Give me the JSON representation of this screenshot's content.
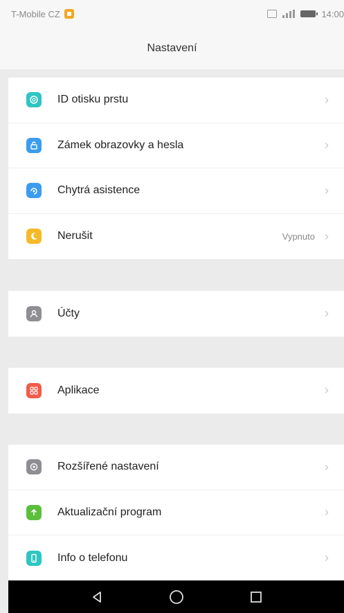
{
  "status_bar": {
    "carrier": "T-Mobile CZ",
    "time": "14:00"
  },
  "header": {
    "title": "Nastavení"
  },
  "groups": [
    {
      "items": [
        {
          "label": "ID otisku prstu",
          "icon": "fingerprint-icon",
          "color": "#2ec5c2"
        },
        {
          "label": "Zámek obrazovky a hesla",
          "icon": "lock-icon",
          "color": "#3b9cf0"
        },
        {
          "label": "Chytrá asistence",
          "icon": "assist-icon",
          "color": "#3b9cf0"
        },
        {
          "label": "Nerušit",
          "value": "Vypnuto",
          "icon": "moon-icon",
          "color": "#f6b928"
        }
      ]
    },
    {
      "items": [
        {
          "label": "Účty",
          "icon": "account-icon",
          "color": "#8e8e93"
        }
      ]
    },
    {
      "items": [
        {
          "label": "Aplikace",
          "icon": "apps-icon",
          "color": "#f25a4a"
        }
      ]
    },
    {
      "items": [
        {
          "label": "Rozšířené nastavení",
          "icon": "gear-icon",
          "color": "#8e8e93"
        },
        {
          "label": "Aktualizační program",
          "icon": "update-icon",
          "color": "#5cbf3c"
        },
        {
          "label": "Info o telefonu",
          "icon": "phone-info-icon",
          "color": "#2ec5c2"
        }
      ]
    }
  ]
}
